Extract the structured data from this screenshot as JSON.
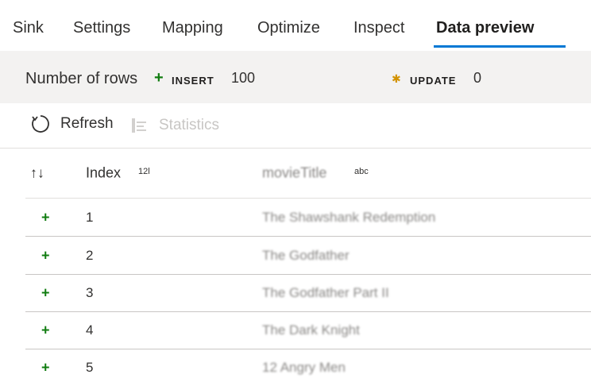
{
  "tabs": [
    {
      "label": "Sink",
      "active": false
    },
    {
      "label": "Settings",
      "active": false
    },
    {
      "label": "Mapping",
      "active": false
    },
    {
      "label": "Optimize",
      "active": false
    },
    {
      "label": "Inspect",
      "active": false
    },
    {
      "label": "Data preview",
      "active": true
    }
  ],
  "summary": {
    "label": "Number of rows",
    "insert_icon": "+",
    "insert_tag": "INSERT",
    "insert_count": "100",
    "update_icon": "✱",
    "update_tag": "UPDATE",
    "update_count": "0"
  },
  "toolbar": {
    "refresh_label": "Refresh",
    "statistics_label": "Statistics"
  },
  "grid": {
    "sort_icon": "↑↓",
    "columns": [
      {
        "label": "Index",
        "type": "12l"
      },
      {
        "label": "movieTitle",
        "type": "abc"
      }
    ],
    "rows": [
      {
        "op": "+",
        "index": "1",
        "title": "The Shawshank Redemption"
      },
      {
        "op": "+",
        "index": "2",
        "title": "The Godfather"
      },
      {
        "op": "+",
        "index": "3",
        "title": "The Godfather Part II"
      },
      {
        "op": "+",
        "index": "4",
        "title": "The Dark Knight"
      },
      {
        "op": "+",
        "index": "5",
        "title": "12 Angry Men"
      }
    ]
  },
  "colors": {
    "accent": "#0078d4",
    "insert": "#107c10",
    "update": "#d29200",
    "summary_bg": "#f3f2f1"
  }
}
